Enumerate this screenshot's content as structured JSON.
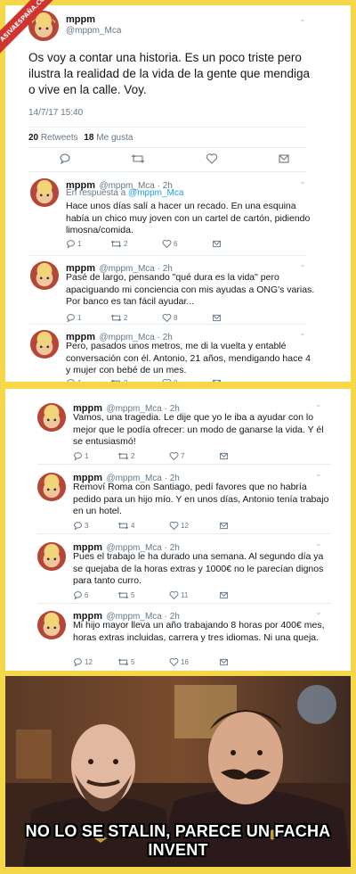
{
  "watermark": "ASIVAESPAÑA.COM",
  "main_tweet": {
    "name": "mppm",
    "handle": "@mppm_Mca",
    "text": "Os voy a contar una historia. Es un poco triste pero ilustra la realidad de la vida de la gente que mendiga o vive en la calle. Voy.",
    "timestamp": "14/7/17 15:40",
    "retweets_count": "20",
    "retweets_label": "Retweets",
    "likes_count": "18",
    "likes_label": "Me gusta"
  },
  "replies_group1": [
    {
      "name": "mppm",
      "handle": "@mppm_Mca · 2h",
      "reply_prefix": "En respuesta a",
      "reply_to": "@mppm_Mca",
      "text": "Hace unos días salí a hacer un recado. En una esquina había un chico muy joven con un cartel de cartón, pidiendo limosna/comida.",
      "replies": "1",
      "retweets": "2",
      "likes": "6"
    },
    {
      "name": "mppm",
      "handle": "@mppm_Mca · 2h",
      "text": "Pasé de largo, pensando \"qué dura es la vida\" pero apaciguando mi conciencia con mis ayudas a ONG's varias. Por banco es tan fácil ayudar...",
      "replies": "1",
      "retweets": "2",
      "likes": "8"
    },
    {
      "name": "mppm",
      "handle": "@mppm_Mca · 2h",
      "text": "Pero, pasados unos metros, me di la vuelta y entablé conversación con él. Antonio, 21 años, mendigando hace 4 y mujer con bebé de un mes.",
      "replies": "1",
      "retweets": "3",
      "likes": "8"
    }
  ],
  "replies_group2": [
    {
      "name": "mppm",
      "handle": "@mppm_Mca · 2h",
      "text": "Vamos, una tragedia. Le dije que yo le iba a ayudar con lo mejor que le podía ofrecer: un modo de ganarse la vida. Y él se entusiasmó!",
      "replies": "1",
      "retweets": "2",
      "likes": "7"
    },
    {
      "name": "mppm",
      "handle": "@mppm_Mca · 2h",
      "text": "Removí Roma con Santiago, pedí favores que no habría pedido para un hijo mío. Y en unos días, Antonio tenía trabajo en un hotel.",
      "replies": "3",
      "retweets": "4",
      "likes": "12"
    },
    {
      "name": "mppm",
      "handle": "@mppm_Mca · 2h",
      "text": "Pues el trabajo le ha durado una semana. Al segundo día ya se quejaba de la horas extras y 1000€ no le parecían dignos para tanto curro.",
      "replies": "6",
      "retweets": "5",
      "likes": "11"
    },
    {
      "name": "mppm",
      "handle": "@mppm_Mca · 2h",
      "text": "Mi hijo mayor lleva un año trabajando 8 horas por 400€ mes, horas extras incluidas, carrera y tres idiomas. Ni una queja.",
      "replies": "12",
      "retweets": "5",
      "likes": "16"
    }
  ],
  "meme": {
    "caption": "NO LO SE STALIN, PARECE UN FACHA INVENT"
  },
  "icons": {
    "reply": "reply-icon",
    "retweet": "retweet-icon",
    "like": "heart-icon",
    "dm": "envelope-icon"
  }
}
